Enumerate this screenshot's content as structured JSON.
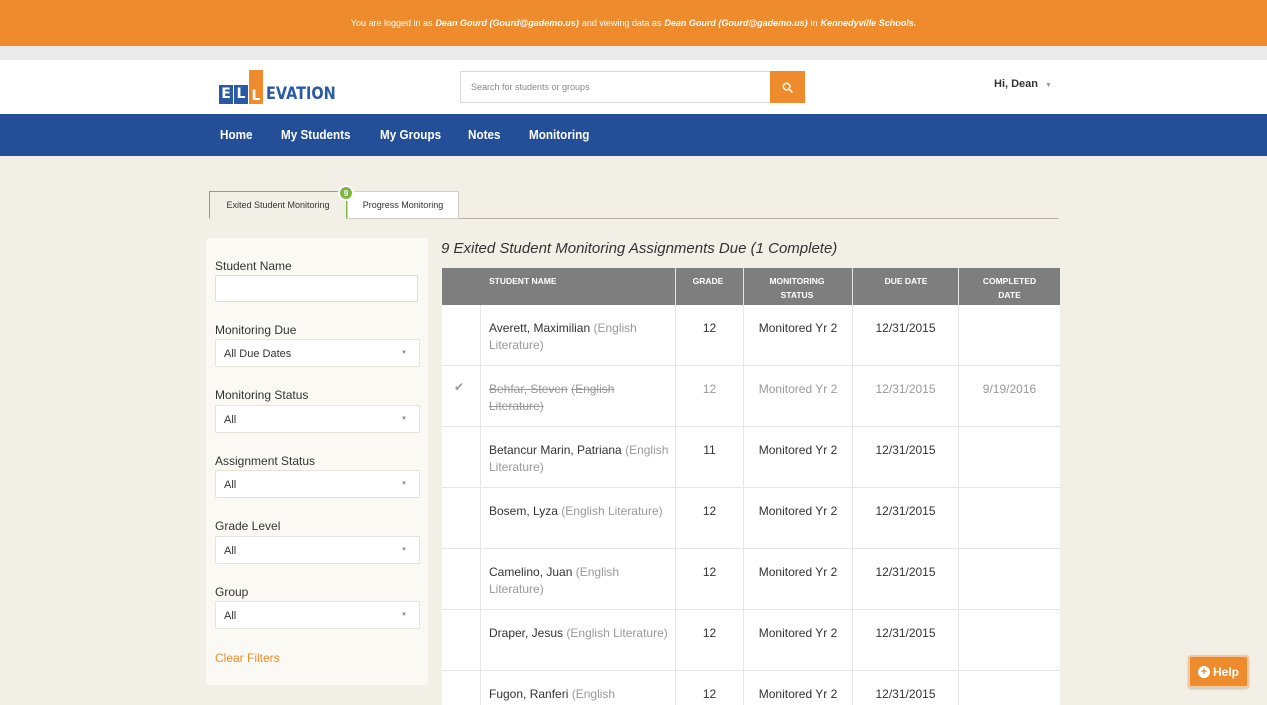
{
  "banner": {
    "prefix": "You are logged in as",
    "user": "Dean Gourd (Gourd@gademo.us)",
    "middle": "and viewing data as",
    "viewing_as": "Dean Gourd (Gourd@gademo.us)",
    "in_text": "in",
    "district": "Kennedyville Schools."
  },
  "header": {
    "logo_letters": [
      "E",
      "L",
      "L"
    ],
    "logo_text": "EVATION",
    "search_placeholder": "Search for students or groups",
    "greeting": "Hi, Dean"
  },
  "nav": [
    "Home",
    "My Students",
    "My Groups",
    "Notes",
    "Monitoring"
  ],
  "tabs": {
    "active": "Exited Student Monitoring",
    "inactive": "Progress Monitoring",
    "badge": "9"
  },
  "filters": {
    "student_name_label": "Student Name",
    "student_name_value": "",
    "monitoring_due_label": "Monitoring Due",
    "monitoring_due_value": "All Due Dates",
    "monitoring_status_label": "Monitoring Status",
    "monitoring_status_value": "All",
    "assignment_status_label": "Assignment Status",
    "assignment_status_value": "All",
    "grade_level_label": "Grade Level",
    "grade_level_value": "All",
    "group_label": "Group",
    "group_value": "All",
    "clear": "Clear Filters"
  },
  "main": {
    "heading": "9 Exited Student Monitoring Assignments Due (1 Complete)"
  },
  "table": {
    "headers": {
      "student_name": "STUDENT NAME",
      "grade": "GRADE",
      "monitoring_status_1": "MONITORING",
      "monitoring_status_2": "STATUS",
      "due_date": "DUE DATE",
      "completed_date_1": "COMPLETED",
      "completed_date_2": "DATE"
    },
    "rows": [
      {
        "check": "",
        "name": "Averett, Maximilian",
        "course": "(English Literature)",
        "grade": "12",
        "status": "Monitored Yr 2",
        "due": "12/31/2015",
        "completed": ""
      },
      {
        "check": "✔",
        "name": "Behfar, Steven",
        "course": "(English Literature)",
        "grade": "12",
        "status": "Monitored Yr 2",
        "due": "12/31/2015",
        "completed": "9/19/2016"
      },
      {
        "check": "",
        "name": "Betancur Marin, Patriana",
        "course": "(English Literature)",
        "grade": "11",
        "status": "Monitored Yr 2",
        "due": "12/31/2015",
        "completed": ""
      },
      {
        "check": "",
        "name": "Bosem, Lyza",
        "course": "(English Literature)",
        "grade": "12",
        "status": "Monitored Yr 2",
        "due": "12/31/2015",
        "completed": ""
      },
      {
        "check": "",
        "name": "Camelino, Juan",
        "course": "(English Literature)",
        "grade": "12",
        "status": "Monitored Yr 2",
        "due": "12/31/2015",
        "completed": ""
      },
      {
        "check": "",
        "name": "Draper, Jesus",
        "course": "(English Literature)",
        "grade": "12",
        "status": "Monitored Yr 2",
        "due": "12/31/2015",
        "completed": ""
      },
      {
        "check": "",
        "name": "Fugon, Ranferi",
        "course": "(English",
        "grade": "12",
        "status": "Monitored Yr 2",
        "due": "12/31/2015",
        "completed": ""
      }
    ]
  },
  "help": {
    "label": "Help"
  },
  "colors": {
    "orange": "#ee8b2d",
    "nav_blue": "#234f98",
    "green": "#7fb544",
    "header_gray": "#7e7e7e"
  }
}
